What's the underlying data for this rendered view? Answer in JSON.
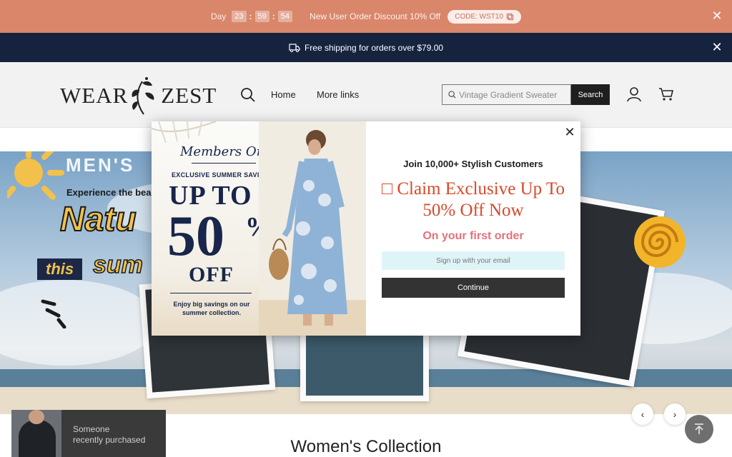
{
  "promo_bar": {
    "day_label": "Day",
    "timer": [
      "23",
      "59",
      "54"
    ],
    "message": "New User Order Discount 10% Off",
    "code": "CODE: WST10"
  },
  "shipping_bar": {
    "message": "Free shipping for orders over $79.00"
  },
  "header": {
    "logo_left": "WEAR",
    "logo_right": "ZEST",
    "nav": [
      "Home",
      "More links"
    ],
    "search_placeholder": "Vintage Gradient Sweater",
    "search_button": "Search"
  },
  "hero": {
    "title": "MEN'S",
    "subtitle": "Experience the bea",
    "headline": "Natu",
    "this": "this",
    "sum": "sum"
  },
  "modal": {
    "left": {
      "members": "Members Only",
      "exclusive": "EXCLUSIVE SUMMER SAVINGS",
      "up_to": "UP TO",
      "fifty": "50",
      "percent": "%",
      "off": "OFF",
      "enjoy": "Enjoy big savings on our summer collection."
    },
    "join": "Join 10,000+ Stylish Customers",
    "claim": "□ Claim Exclusive Up To 50% Off Now",
    "first_order": "On your first order",
    "email_placeholder": "Sign up with your email",
    "continue": "Continue"
  },
  "toast": {
    "line1": "Someone",
    "line2": "recently purchased"
  },
  "collection_title": "Women's Collection",
  "colors": {
    "promo": "#d9866b",
    "ship": "#16233f",
    "claim": "#d7492a",
    "first_order": "#e8707b"
  }
}
